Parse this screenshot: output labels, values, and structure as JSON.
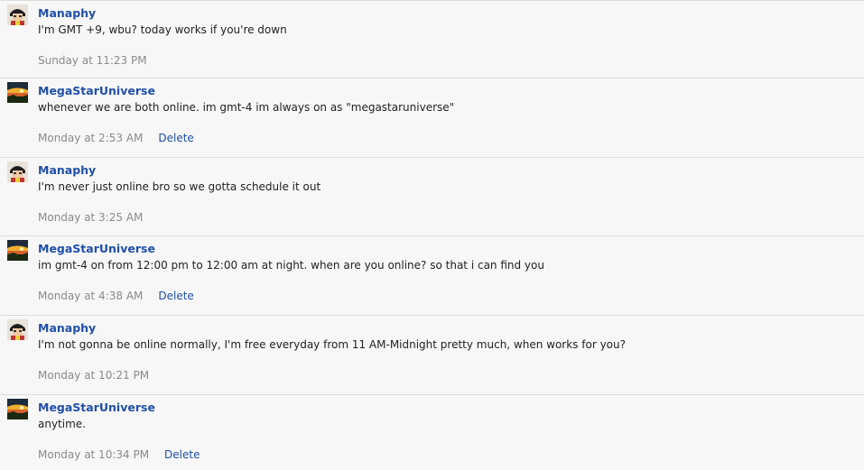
{
  "messages": [
    {
      "author": "Manaphy",
      "avatar": "manaphy-avatar",
      "text": "I'm GMT +9, wbu? today works if you're down",
      "time": "Sunday at 11:23 PM",
      "delete": ""
    },
    {
      "author": "MegaStarUniverse",
      "avatar": "megastaruniverse-avatar",
      "text": "whenever we are both online. im gmt-4 im always on as \"megastaruniverse\"",
      "time": "Monday at 2:53 AM",
      "delete": "Delete"
    },
    {
      "author": "Manaphy",
      "avatar": "manaphy-avatar",
      "text": "I'm never just online bro so we gotta schedule it out",
      "time": "Monday at 3:25 AM",
      "delete": ""
    },
    {
      "author": "MegaStarUniverse",
      "avatar": "megastaruniverse-avatar",
      "text": "im gmt-4 on from 12:00 pm to 12:00 am at night. when are you online? so that i can find you",
      "time": "Monday at 4:38 AM",
      "delete": "Delete"
    },
    {
      "author": "Manaphy",
      "avatar": "manaphy-avatar",
      "text": "I'm not gonna be online normally, I'm free everyday from 11 AM-Midnight pretty much, when works for you?",
      "time": "Monday at 10:21 PM",
      "delete": ""
    },
    {
      "author": "MegaStarUniverse",
      "avatar": "megastaruniverse-avatar",
      "text": "anytime.",
      "time": "Monday at 10:34 PM",
      "delete": "Delete"
    }
  ],
  "colors": {
    "author_link": "#1f4fa8",
    "timestamp": "#8a8a8a",
    "background": "#f7f7f7",
    "divider": "#dcdcdc"
  }
}
